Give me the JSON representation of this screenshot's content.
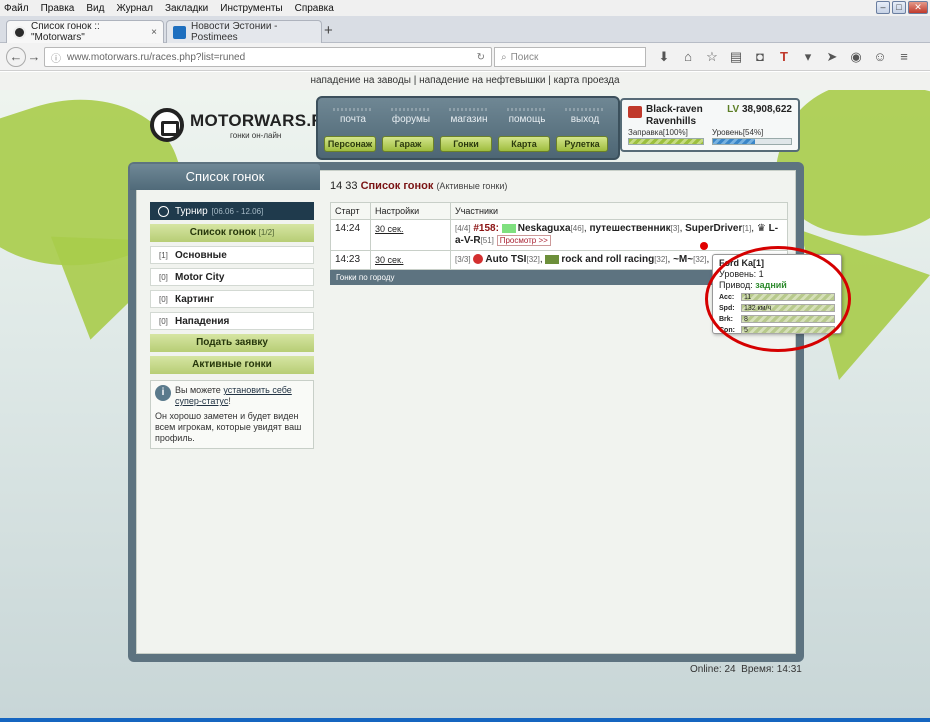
{
  "menubar": [
    "Файл",
    "Правка",
    "Вид",
    "Журнал",
    "Закладки",
    "Инструменты",
    "Справка"
  ],
  "tabs": [
    {
      "title": "Список гонок :: \"Motorwars\"",
      "icon_color": "#2b2b2b"
    },
    {
      "title": "Новости Эстонии - Postimees",
      "icon_color": "#1e6fbf"
    }
  ],
  "tab_close": "×",
  "new_tab": "+",
  "url": "www.motorwars.ru/races.php?list=runed",
  "search_placeholder": "Поиск",
  "top_links": "нападение на заводы | нападение на нефтевышки | карта проезда",
  "logo": {
    "name": "MOTORWARS.RU",
    "tagline": "гонки он-лайн"
  },
  "nav_top": [
    "почта",
    "форумы",
    "магазин",
    "помощь",
    "выход"
  ],
  "nav_bottom": [
    "Персонаж",
    "Гараж",
    "Гонки",
    "Карта",
    "Рулетка"
  ],
  "player": {
    "name": "Black-raven Ravenhills",
    "level_label": "LV",
    "level_value": "38,908,622",
    "fuel_label": "Заправка[100%]",
    "fuel_pct": 100,
    "level_bar_label": "Уровень[54%]",
    "level_pct": 54
  },
  "sidebar": {
    "title": "Список гонок",
    "tournament": {
      "label": "Турнир",
      "dates": "[06.06 - 12.06]"
    },
    "list_btn": {
      "label": "Список гонок",
      "count": "[1/2]"
    },
    "items": [
      {
        "count": "[1]",
        "label": "Основные"
      },
      {
        "count": "[0]",
        "label": "Motor City"
      },
      {
        "count": "[0]",
        "label": "Картинг"
      },
      {
        "count": "[0]",
        "label": "Нападения"
      }
    ],
    "apply_btn": "Подать заявку",
    "active_btn": "Активные гонки",
    "info": {
      "text1": "Вы можете ",
      "link": "установить себе супер-статус",
      "text1_end": "!",
      "text2": "Он хорошо заметен и будет виден всем игрокам, которые увидят ваш профиль."
    }
  },
  "content": {
    "time": "14 33",
    "title": "Список гонок",
    "subtitle": "(Активные гонки)",
    "headers": [
      "Старт",
      "Настройки",
      "Участники"
    ],
    "rows": [
      {
        "start": "14:24",
        "settings": "30 сек.",
        "slots": "[4/4]",
        "race_no": "#158:",
        "players": [
          {
            "name": "Neskaguxa",
            "lv": "[46]"
          },
          {
            "name": "путешественник",
            "lv": "[3]"
          },
          {
            "name": "SuperDriver",
            "lv": "[1]"
          },
          {
            "name": "L-a-V-R",
            "lv": "[51]"
          }
        ],
        "view": "Просмотр >>"
      },
      {
        "start": "14:23",
        "settings": "30 сек.",
        "slots": "[3/3]",
        "players": [
          {
            "name": "Auto TSI",
            "lv": "[32]"
          },
          {
            "name": "rock and roll racing",
            "lv": "[32]"
          },
          {
            "name": "~M~",
            "lv": "[32]"
          }
        ],
        "tail": "Fo"
      }
    ],
    "footer": "Гонки по городу"
  },
  "tooltip": {
    "name": "Ford Ka[1]",
    "level": "Уровень: 1",
    "drive_label": "Привод: ",
    "drive_value": "задний",
    "stats": [
      {
        "k": "Acc:",
        "v": "11"
      },
      {
        "k": "Spd:",
        "v": "132 км/ч"
      },
      {
        "k": "Brk:",
        "v": "8"
      },
      {
        "k": "Con:",
        "v": "5"
      }
    ]
  },
  "status": {
    "online": "Online: 24",
    "time": "Время: 14:31"
  }
}
